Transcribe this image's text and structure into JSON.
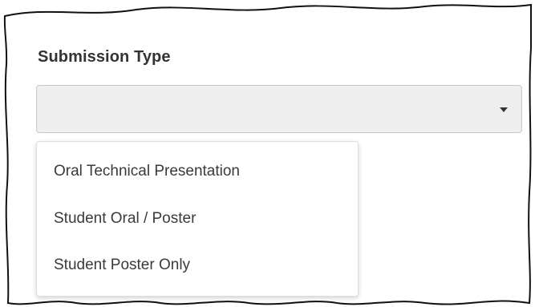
{
  "form": {
    "field_label": "Submission Type",
    "selected_value": "",
    "options": [
      "Oral Technical Presentation",
      "Student Oral / Poster",
      "Student Poster Only"
    ]
  },
  "icons": {
    "caret": "caret-down-icon"
  },
  "colors": {
    "select_background": "#eeeeee",
    "label_text": "#333333",
    "option_text": "#3a3a3a"
  }
}
